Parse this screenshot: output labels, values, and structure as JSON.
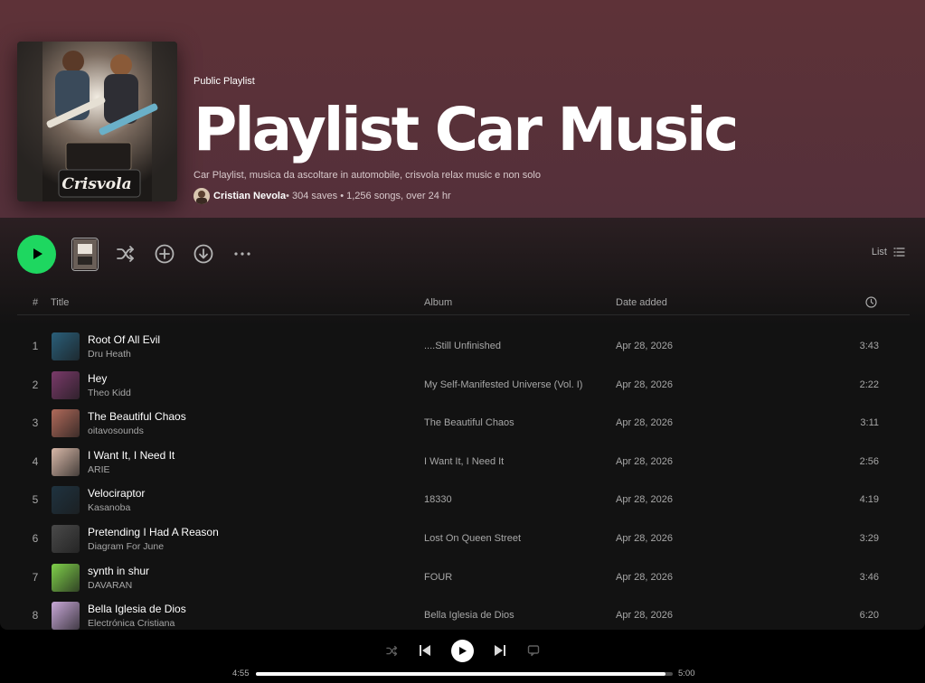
{
  "playlist": {
    "type_label": "Public Playlist",
    "title": "Playlist Car Music",
    "description": "Car Playlist, musica da ascoltare in automobile, crisvola relax music e non solo",
    "owner": "Cristian Nevola",
    "stats": " • 304 saves • 1,256 songs, over 24 hr",
    "cover_logo": "Crisvola"
  },
  "view_toggle": {
    "label": "List"
  },
  "table": {
    "headers": {
      "num": "#",
      "title": "Title",
      "album": "Album",
      "date": "Date added"
    },
    "tracks": [
      {
        "num": "1",
        "title": "Root Of All Evil",
        "artist": "Dru Heath",
        "album": "....Still Unfinished",
        "date": "Apr 28, 2026",
        "duration": "3:43",
        "art_color": "#2a5f7a"
      },
      {
        "num": "2",
        "title": "Hey",
        "artist": "Theo Kidd",
        "album": "My Self-Manifested Universe (Vol. I)",
        "date": "Apr 28, 2026",
        "duration": "2:22",
        "art_color": "#7a3a6a"
      },
      {
        "num": "3",
        "title": "The Beautiful Chaos",
        "artist": "oitavosounds",
        "album": "The Beautiful Chaos",
        "date": "Apr 28, 2026",
        "duration": "3:11",
        "art_color": "#b06a5a"
      },
      {
        "num": "4",
        "title": "I Want It, I Need It",
        "artist": "ARIE",
        "album": "I Want It, I Need It",
        "date": "Apr 28, 2026",
        "duration": "2:56",
        "art_color": "#d8b8a8"
      },
      {
        "num": "5",
        "title": "Velociraptor",
        "artist": "Kasanoba",
        "album": "18330",
        "date": "Apr 28, 2026",
        "duration": "4:19",
        "art_color": "#1f3340"
      },
      {
        "num": "6",
        "title": "Pretending I Had A Reason",
        "artist": "Diagram For June",
        "album": "Lost On Queen Street",
        "date": "Apr 28, 2026",
        "duration": "3:29",
        "art_color": "#4a4a4a"
      },
      {
        "num": "7",
        "title": "synth in shur",
        "artist": "DAVARAN",
        "album": "FOUR",
        "date": "Apr 28, 2026",
        "duration": "3:46",
        "art_color": "#7fd04a"
      },
      {
        "num": "8",
        "title": "Bella Iglesia de Dios",
        "artist": "Electrónica Cristiana",
        "album": "Bella Iglesia de Dios",
        "date": "Apr 28, 2026",
        "duration": "6:20",
        "art_color": "#c8a8d8"
      }
    ]
  },
  "player": {
    "elapsed": "4:55",
    "total": "5:00",
    "progress": 0.983
  },
  "colors": {
    "accent": "#1ed760",
    "hero": "#5e3238",
    "background": "#121212"
  },
  "icons": {
    "actions": [
      "play-icon",
      "shuffle-icon",
      "add-circle-icon",
      "download-icon",
      "more-icon",
      "list-icon",
      "clock-icon"
    ],
    "player": [
      "shuffle-icon",
      "previous-icon",
      "play-icon",
      "next-icon",
      "queue-icon"
    ]
  }
}
